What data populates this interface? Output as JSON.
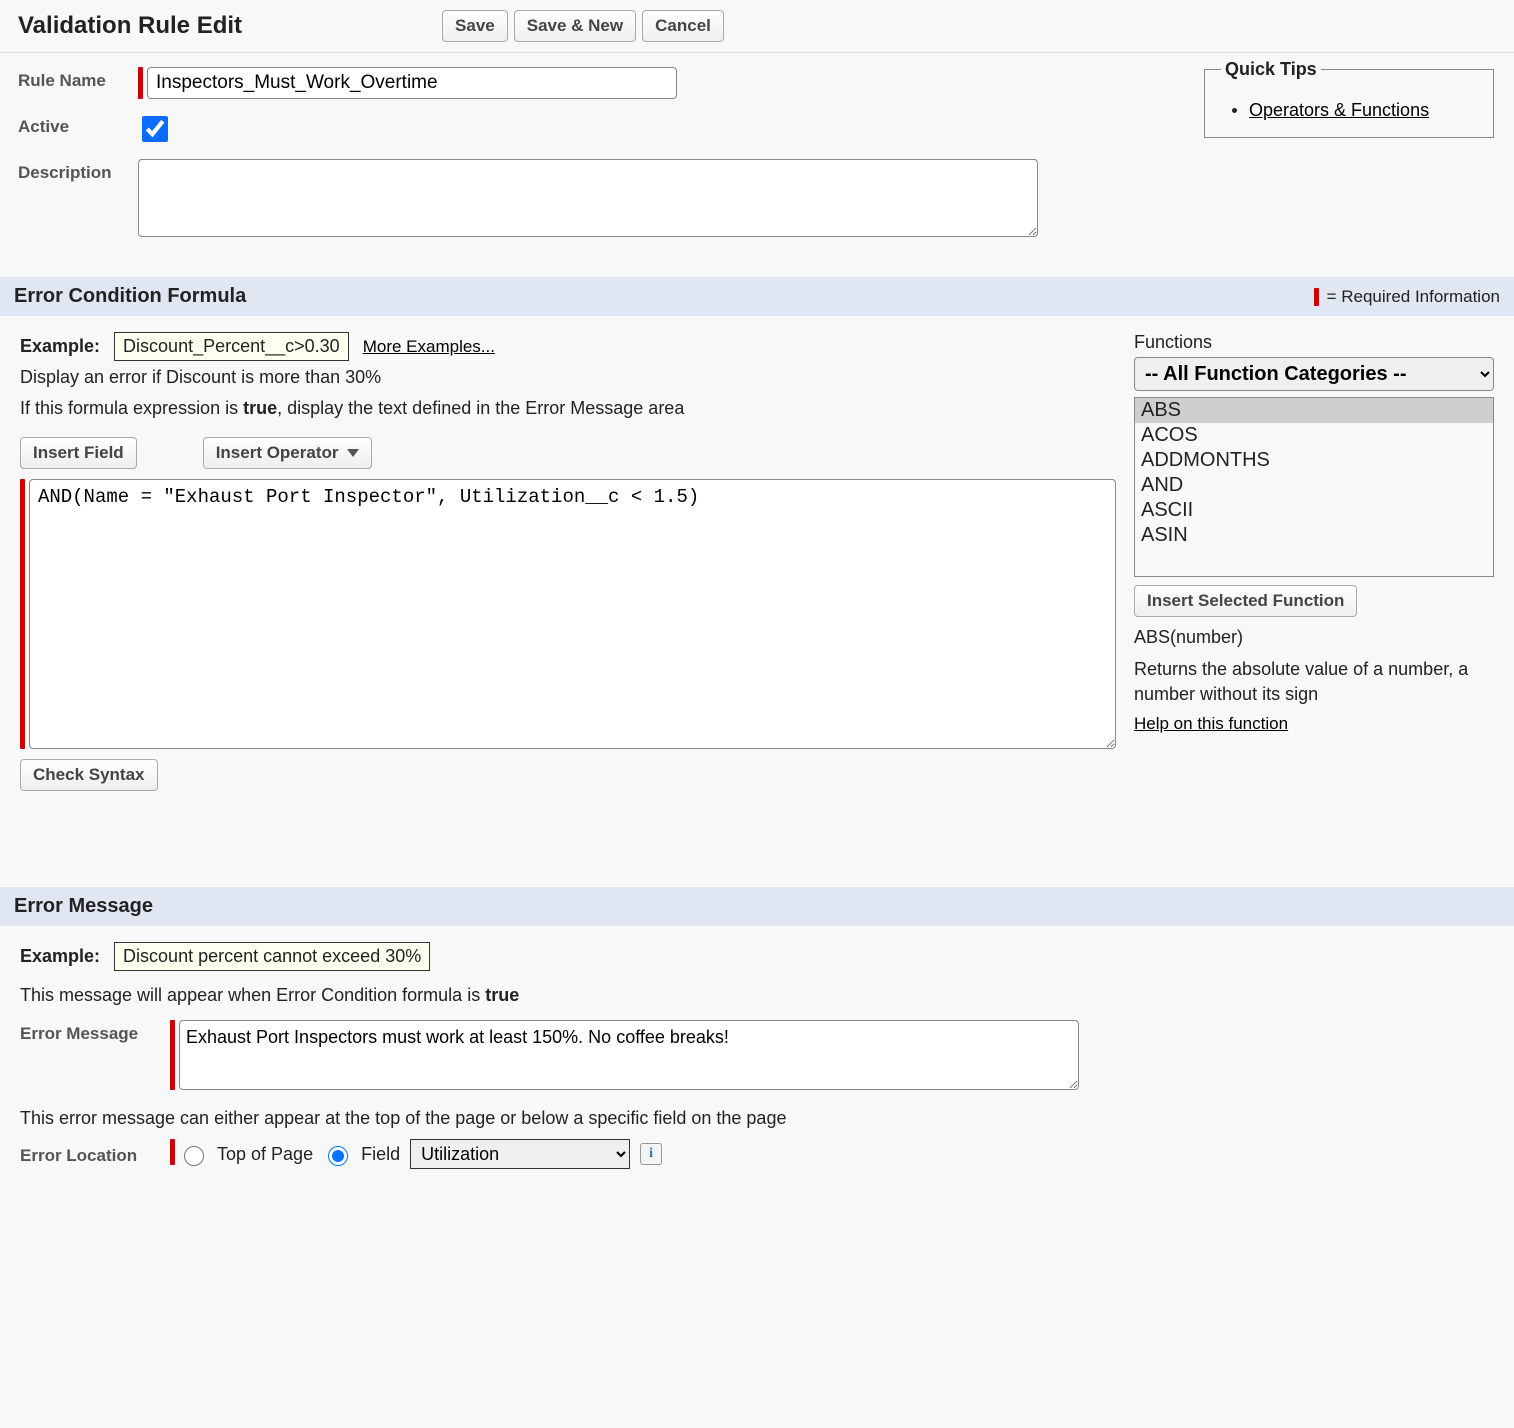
{
  "header": {
    "title": "Validation Rule Edit",
    "buttons": {
      "save": "Save",
      "save_new": "Save & New",
      "cancel": "Cancel"
    }
  },
  "form": {
    "rule_name_label": "Rule Name",
    "rule_name_value": "Inspectors_Must_Work_Overtime",
    "active_label": "Active",
    "active_checked": true,
    "description_label": "Description",
    "description_value": ""
  },
  "quick_tips": {
    "legend": "Quick Tips",
    "link": "Operators & Functions"
  },
  "formula_section": {
    "header": "Error Condition Formula",
    "required_info": "= Required Information",
    "example_label": "Example:",
    "example_code": "Discount_Percent__c>0.30",
    "more_examples": "More Examples...",
    "example_hint": "Display an error if Discount is more than 30%",
    "instruction_pre": "If this formula expression is ",
    "instruction_bold": "true",
    "instruction_post": ", display the text defined in the Error Message area",
    "insert_field": "Insert Field",
    "insert_operator": "Insert Operator",
    "formula_value": "AND(Name = \"Exhaust Port Inspector\", Utilization__c < 1.5)",
    "check_syntax": "Check Syntax"
  },
  "functions": {
    "label": "Functions",
    "category_selected": "-- All Function Categories --",
    "list": [
      "ABS",
      "ACOS",
      "ADDMONTHS",
      "AND",
      "ASCII",
      "ASIN"
    ],
    "selected_index": 0,
    "insert_selected": "Insert Selected Function",
    "signature": "ABS(number)",
    "description": "Returns the absolute value of a number, a number without its sign",
    "help_link": "Help on this function"
  },
  "error_section": {
    "header": "Error Message",
    "example_label": "Example:",
    "example_text": "Discount percent cannot exceed 30%",
    "hint_pre": "This message will appear when Error Condition formula is ",
    "hint_bold": "true",
    "message_label": "Error Message",
    "message_value": "Exhaust Port Inspectors must work at least 150%. No coffee breaks!",
    "location_hint": "This error message can either appear at the top of the page or below a specific field on the page",
    "location_label": "Error Location",
    "top_of_page": "Top of Page",
    "field_label": "Field",
    "selected_location": "field",
    "field_select_value": "Utilization"
  }
}
